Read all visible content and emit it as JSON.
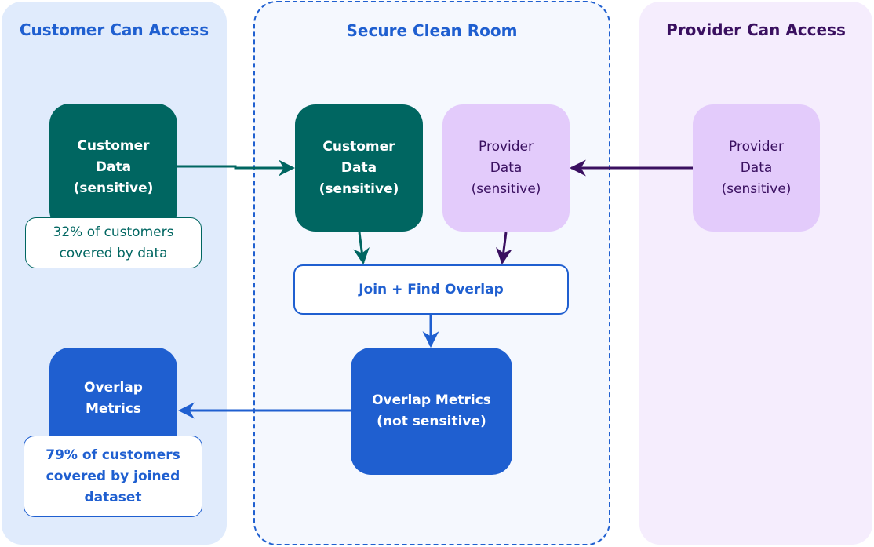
{
  "zones": {
    "customer": {
      "title": "Customer Can Access"
    },
    "clean_room": {
      "title": "Secure Clean Room"
    },
    "provider": {
      "title": "Provider Can Access"
    }
  },
  "nodes": {
    "customer_data_left": {
      "label": "Customer\nData\n(sensitive)"
    },
    "customer_data_clean": {
      "label": "Customer\nData\n(sensitive)"
    },
    "provider_data_clean": {
      "label": "Provider\nData\n(sensitive)"
    },
    "provider_data_right": {
      "label": "Provider\nData\n(sensitive)"
    },
    "join": {
      "label": "Join + Find Overlap"
    },
    "overlap_metrics_clean": {
      "label": "Overlap Metrics\n(not sensitive)"
    },
    "overlap_metrics_left": {
      "label": "Overlap\nMetrics"
    }
  },
  "notes": {
    "customer_coverage": "32% of customers\ncovered by data",
    "joined_coverage": "79% of customers\ncovered by joined\ndataset"
  },
  "colors": {
    "customer_teal": "#006661",
    "provider_purple": "#3a1060",
    "provider_lilac": "#e3cbfb",
    "clean_room_blue": "#1f5fd0"
  }
}
